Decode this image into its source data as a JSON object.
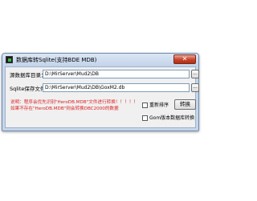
{
  "window": {
    "title": "数据库转Sqlite(支持BDE MDB)",
    "close_label": "✕"
  },
  "form": {
    "source_label": "源数据库目录：",
    "source_value": "D:\\MirServer\\Mud2\\DB",
    "target_label": "Sqlite保存文件：",
    "target_value": "D:\\MirServer\\Mud2\\DB\\GoxM2.db",
    "browse_label": "..."
  },
  "notes": {
    "line1": "说明：程序会优先识别\"HeroDB.MDB\"文件进行转换！！！！！",
    "line2": "如果不存在\"HeroDB.MDB\"则会转换DBC2000的数据"
  },
  "options": {
    "reorder_label": "重新排序",
    "reorder_checked": false,
    "gom_label": "Gom版本数据库转换",
    "gom_checked": false
  },
  "buttons": {
    "convert1": "转换",
    "convert2": "转换"
  }
}
